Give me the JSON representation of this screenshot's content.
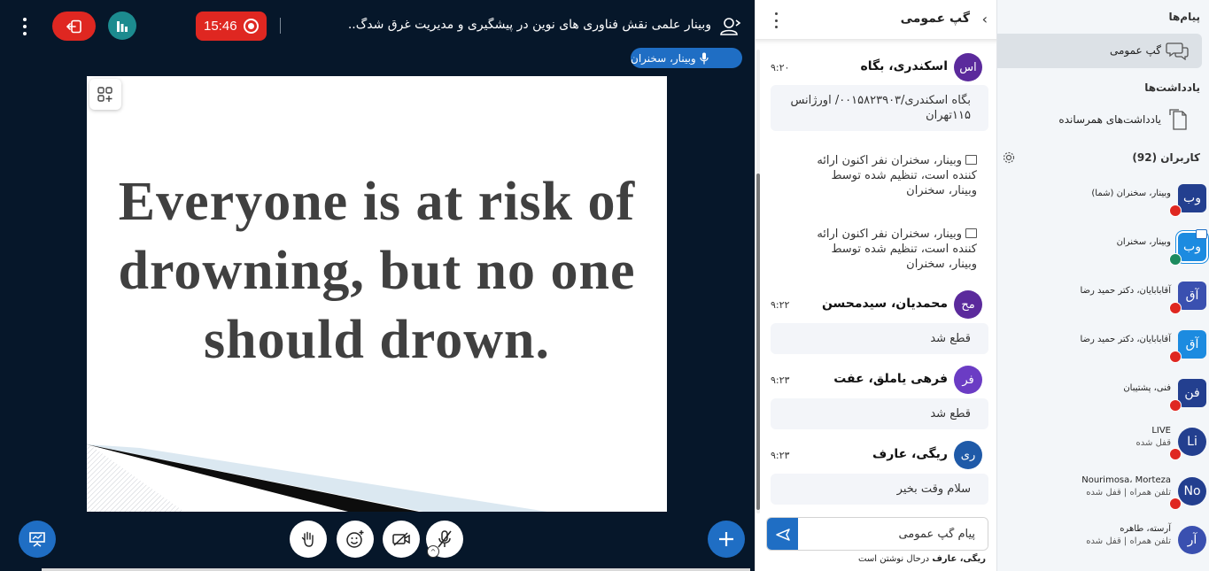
{
  "topbar": {
    "timer": "15:46",
    "meeting_title": "وبینار علمی نقش فناوری های نوین در پیشگیری و مدیریت غرق شدگ.."
  },
  "presenter": {
    "speaker_label": "وبینار، سخنران"
  },
  "slide": {
    "text": "Everyone is at risk of drowning, but no one should drown."
  },
  "chat": {
    "title": "گپ عمومی",
    "messages": [
      {
        "initials": "اس",
        "name": "اسکندری، بگاه",
        "time": "۹:۲۰",
        "color": "#5b2a9c",
        "text": "بگاه اسکندری/۰۰۱۵۸۲۳۹۰۳/ اورژانس ۱۱۵تهران"
      },
      {
        "system": "وبینار، سخنران نفر اکنون ارائه کننده است، تنظیم شده توسط وبینار، سخنران"
      },
      {
        "system": "وبینار، سخنران نفر اکنون ارائه کننده است، تنظیم شده توسط وبینار، سخنران"
      },
      {
        "initials": "مح",
        "name": "محمدیان، سیدمحسن",
        "time": "۹:۲۲",
        "color": "#5b2a9c",
        "text": "قطع شد"
      },
      {
        "initials": "فر",
        "name": "فرهی یاملق، عفت",
        "time": "۹:۲۳",
        "color": "#6b3cc4",
        "text": "قطع شد"
      },
      {
        "initials": "ری",
        "name": "ریگی، عارف",
        "time": "۹:۲۳",
        "color": "#1f5aa8",
        "text": "سلام وقت بخیر"
      }
    ],
    "input_placeholder": "پیام گپ عمومی",
    "typing_name": "ریگی، عارف",
    "typing_suffix": "درحال نوشتن است"
  },
  "users_panel": {
    "messages_title": "پیام‌ها",
    "public_chat_label": "گپ عمومی",
    "notes_title": "یادداشت‌ها",
    "shared_notes_label": "یادداشت‌های همرسانده",
    "users_title": "کاربران (92)",
    "users": [
      {
        "initials": "وب",
        "name": "وبینار، سخنران (شما)",
        "sub": "",
        "color": "#233f8f",
        "shape": "square",
        "status": "muted"
      },
      {
        "initials": "وب",
        "name": "وبینار، سخنران",
        "sub": "",
        "color": "#1c8be0",
        "shape": "square",
        "status": "talking",
        "presenter": true
      },
      {
        "initials": "آق",
        "name": "آقابابایان، دکتر حمید رضا",
        "sub": "",
        "color": "#3a50b0",
        "shape": "square",
        "status": "muted"
      },
      {
        "initials": "آق",
        "name": "آقابابایان، دکتر حمید رضا",
        "sub": "",
        "color": "#1c8be0",
        "shape": "square",
        "status": "muted"
      },
      {
        "initials": "فن",
        "name": "فنی، پشتیبان",
        "sub": "",
        "color": "#233f8f",
        "shape": "square",
        "status": "muted"
      },
      {
        "initials": "Li",
        "name": "LIVE",
        "sub": "قفل شده",
        "color": "#233f8f",
        "shape": "round",
        "status": "muted"
      },
      {
        "initials": "No",
        "name": "Nourimosa، Morteza",
        "sub": "تلفن همراه | قفل شده",
        "color": "#233f8f",
        "shape": "round",
        "status": "muted"
      },
      {
        "initials": "آر",
        "name": "آرسته، طاهره",
        "sub": "تلفن همراه | قفل شده",
        "color": "#3a50b0",
        "shape": "round",
        "status": "none"
      }
    ]
  },
  "colors": {
    "main_bg": "#06172a",
    "accent": "#1f6ec4",
    "danger": "#df2721",
    "teal": "#1c8b8f"
  }
}
